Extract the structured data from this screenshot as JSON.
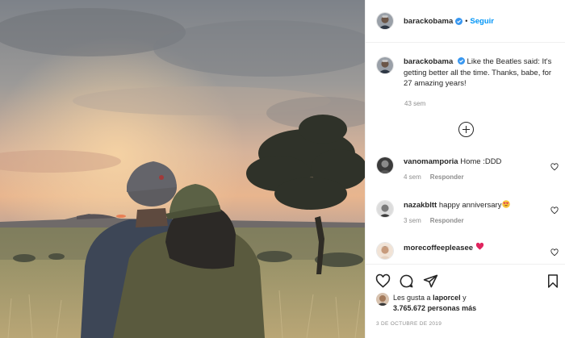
{
  "post": {
    "author": "barackobama",
    "dot": "•",
    "follow_label": "Seguir",
    "caption": "Like the Beatles said: It's getting better all the time. Thanks, babe, for 27 amazing years!",
    "caption_time": "43 sem",
    "verified_color": "#3897f0"
  },
  "comments": [
    {
      "user": "vanomamporia",
      "text": "Home :DDD",
      "time": "4 sem",
      "reply": "Responder",
      "emoji": ""
    },
    {
      "user": "nazakbltt",
      "text": "happy anniversary",
      "time": "3 sem",
      "reply": "Responder",
      "emoji": "smiling-face-with-heart-eyes"
    },
    {
      "user": "morecoffeepleasee",
      "text": "",
      "time": "",
      "reply": "",
      "emoji": "red-heart"
    }
  ],
  "likes": {
    "prefix": "Les gusta a",
    "user": "laporcel",
    "conj": "y",
    "count": "3.765.672",
    "suffix": "personas más"
  },
  "date": "3 DE OCTUBRE DE 2019",
  "icons": [
    "heart-icon",
    "comment-icon",
    "share-icon",
    "bookmark-icon",
    "add-comment-icon",
    "verified-badge-icon"
  ]
}
